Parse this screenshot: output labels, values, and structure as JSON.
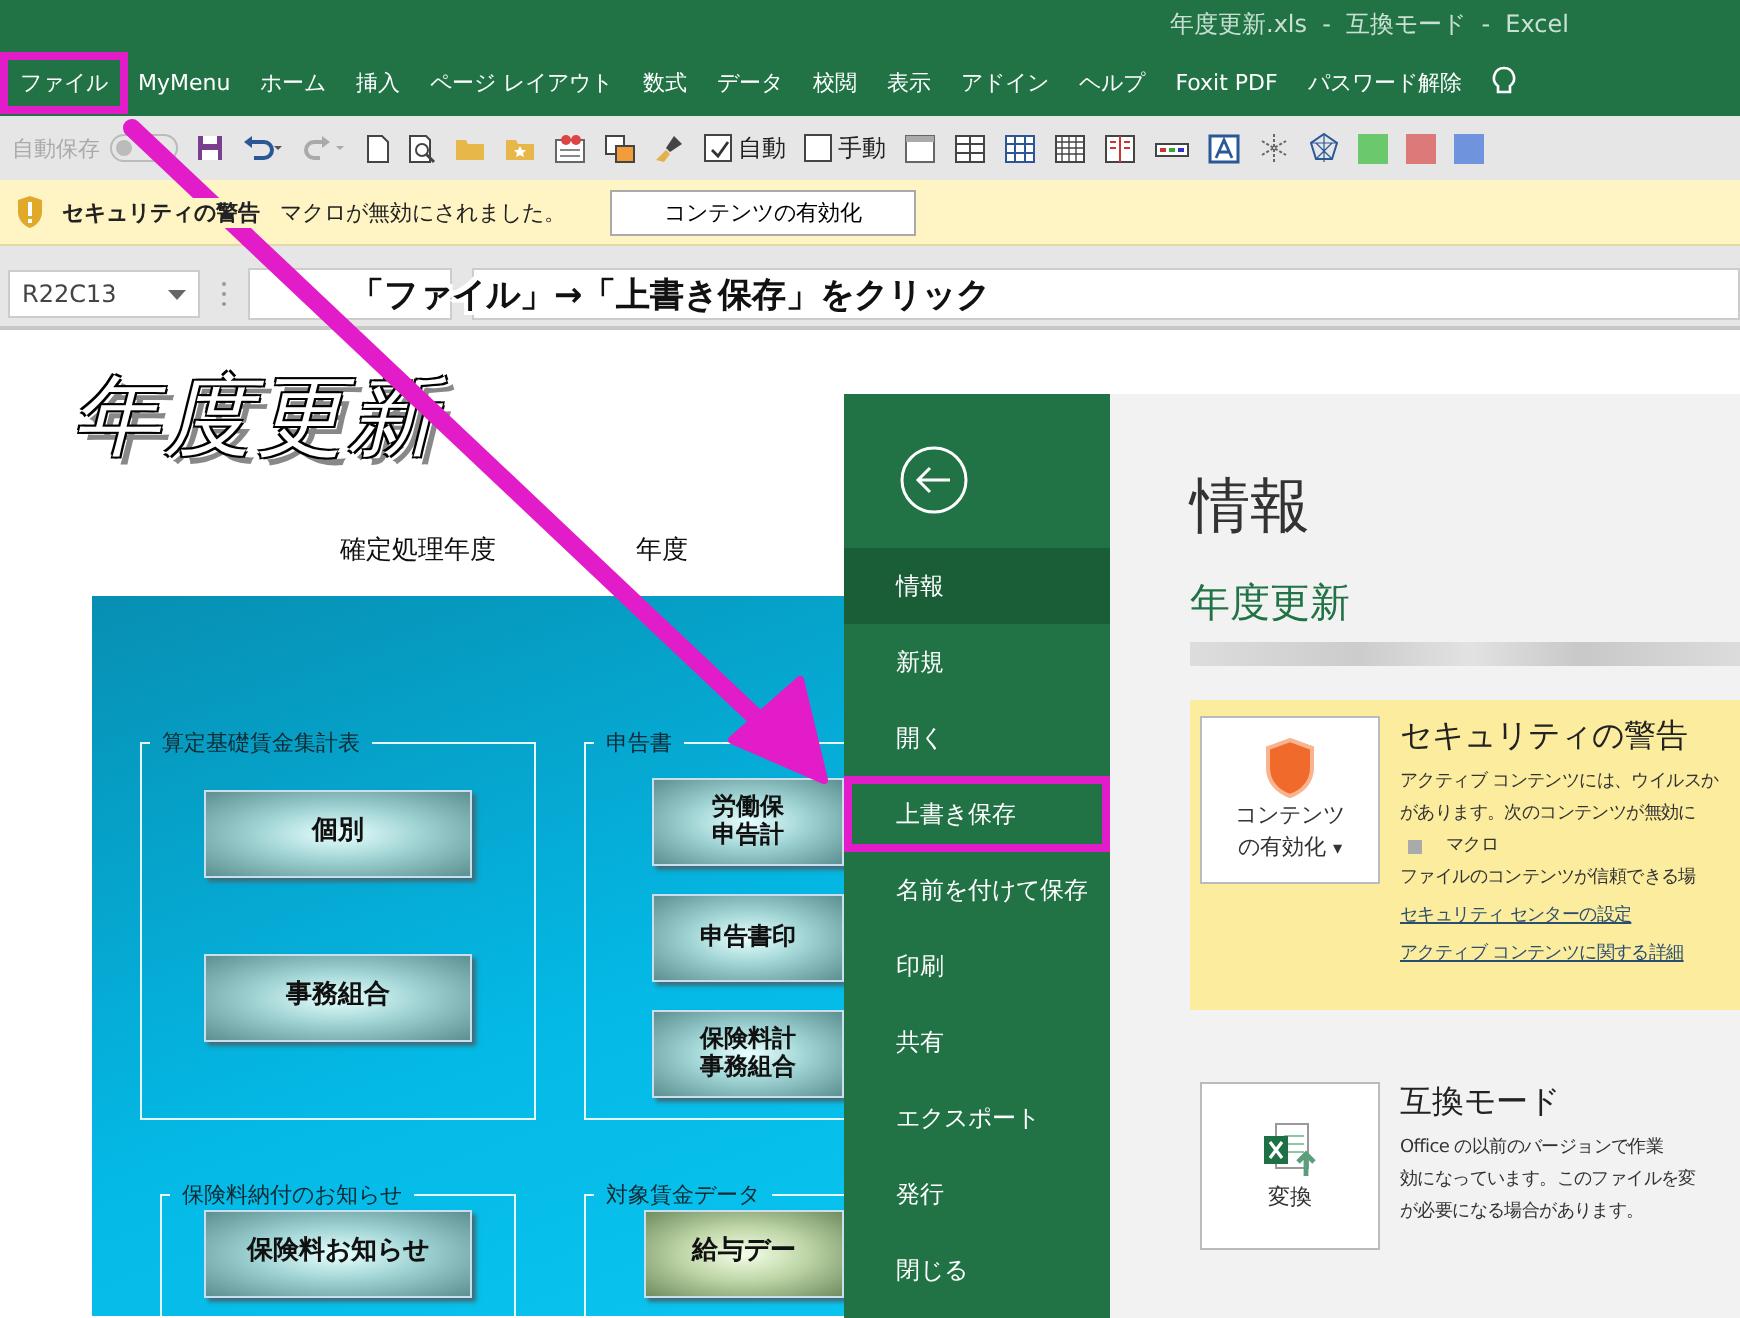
{
  "window": {
    "title": "年度更新.xls  -  互換モード  -  Excel"
  },
  "ribbon_tabs": [
    {
      "label": "ファイル",
      "highlighted": true
    },
    {
      "label": "MyMenu",
      "highlighted": false
    },
    {
      "label": "ホーム",
      "highlighted": false
    },
    {
      "label": "挿入",
      "highlighted": false
    },
    {
      "label": "ページ レイアウト",
      "highlighted": false
    },
    {
      "label": "数式",
      "highlighted": false
    },
    {
      "label": "データ",
      "highlighted": false
    },
    {
      "label": "校閲",
      "highlighted": false
    },
    {
      "label": "表示",
      "highlighted": false
    },
    {
      "label": "アドイン",
      "highlighted": false
    },
    {
      "label": "ヘルプ",
      "highlighted": false
    },
    {
      "label": "Foxit PDF",
      "highlighted": false
    },
    {
      "label": "パスワード解除",
      "highlighted": false
    }
  ],
  "quick_access": {
    "autosave_label": "自動保存",
    "autosave_on": false,
    "checkboxes": [
      {
        "label": "自動",
        "checked": true
      },
      {
        "label": "手動",
        "checked": false
      }
    ]
  },
  "message_bar": {
    "title": "セキュリティの警告",
    "text": "マクロが無効にされました。",
    "button": "コンテンツの有効化"
  },
  "formula_bar": {
    "name_box": "R22C13"
  },
  "annotation": {
    "caption": "「ファイル」→「上書き保存」をクリック"
  },
  "sheet": {
    "title": "年度更新",
    "labels": [
      "確定処理年度",
      "年度"
    ],
    "groups": [
      {
        "title": "算定基礎賃金集計表",
        "buttons": [
          {
            "lines": [
              "個別"
            ],
            "kind": "teal"
          },
          {
            "lines": [
              "事務組合"
            ],
            "kind": "teal"
          }
        ]
      },
      {
        "title": "申告書",
        "buttons": [
          {
            "lines": [
              "労働保",
              "申告計"
            ],
            "kind": "teal"
          },
          {
            "lines": [
              "申告書印"
            ],
            "kind": "teal"
          },
          {
            "lines": [
              "保険料計",
              "事務組合"
            ],
            "kind": "teal"
          }
        ]
      },
      {
        "title": "保険料納付のお知らせ",
        "buttons": [
          {
            "lines": [
              "保険料お知らせ"
            ],
            "kind": "teal"
          }
        ]
      },
      {
        "title": "対象賃金データ",
        "buttons": [
          {
            "lines": [
              "給与デー"
            ],
            "kind": "olive"
          }
        ]
      }
    ]
  },
  "backstage": {
    "menu": [
      {
        "label": "情報",
        "selected": true,
        "highlighted": false
      },
      {
        "label": "新規",
        "selected": false,
        "highlighted": false
      },
      {
        "label": "開く",
        "selected": false,
        "highlighted": false
      },
      {
        "label": "上書き保存",
        "selected": false,
        "highlighted": true
      },
      {
        "label": "名前を付けて保存",
        "selected": false,
        "highlighted": false
      },
      {
        "label": "印刷",
        "selected": false,
        "highlighted": false
      },
      {
        "label": "共有",
        "selected": false,
        "highlighted": false
      },
      {
        "label": "エクスポート",
        "selected": false,
        "highlighted": false
      },
      {
        "label": "発行",
        "selected": false,
        "highlighted": false
      },
      {
        "label": "閉じる",
        "selected": false,
        "highlighted": false
      }
    ],
    "heading": "情報",
    "file_title": "年度更新",
    "security": {
      "button_lines": [
        "コンテンツ",
        "の有効化"
      ],
      "button_caret": "▾",
      "title": "セキュリティの警告",
      "lines": [
        "アクティブ コンテンツには、ウイルスか",
        "があります。次のコンテンツが無効に"
      ],
      "bullets": [
        "マクロ"
      ],
      "note": "ファイルのコンテンツが信頼できる場",
      "links": [
        "セキュリティ センターの設定",
        "アクティブ コンテンツに関する詳細"
      ]
    },
    "compat": {
      "button": "変換",
      "title": "互換モード",
      "lines": [
        "Office の以前のバージョンで作業",
        "効になっています。このファイルを変",
        "が必要になる場合があります。"
      ]
    }
  }
}
